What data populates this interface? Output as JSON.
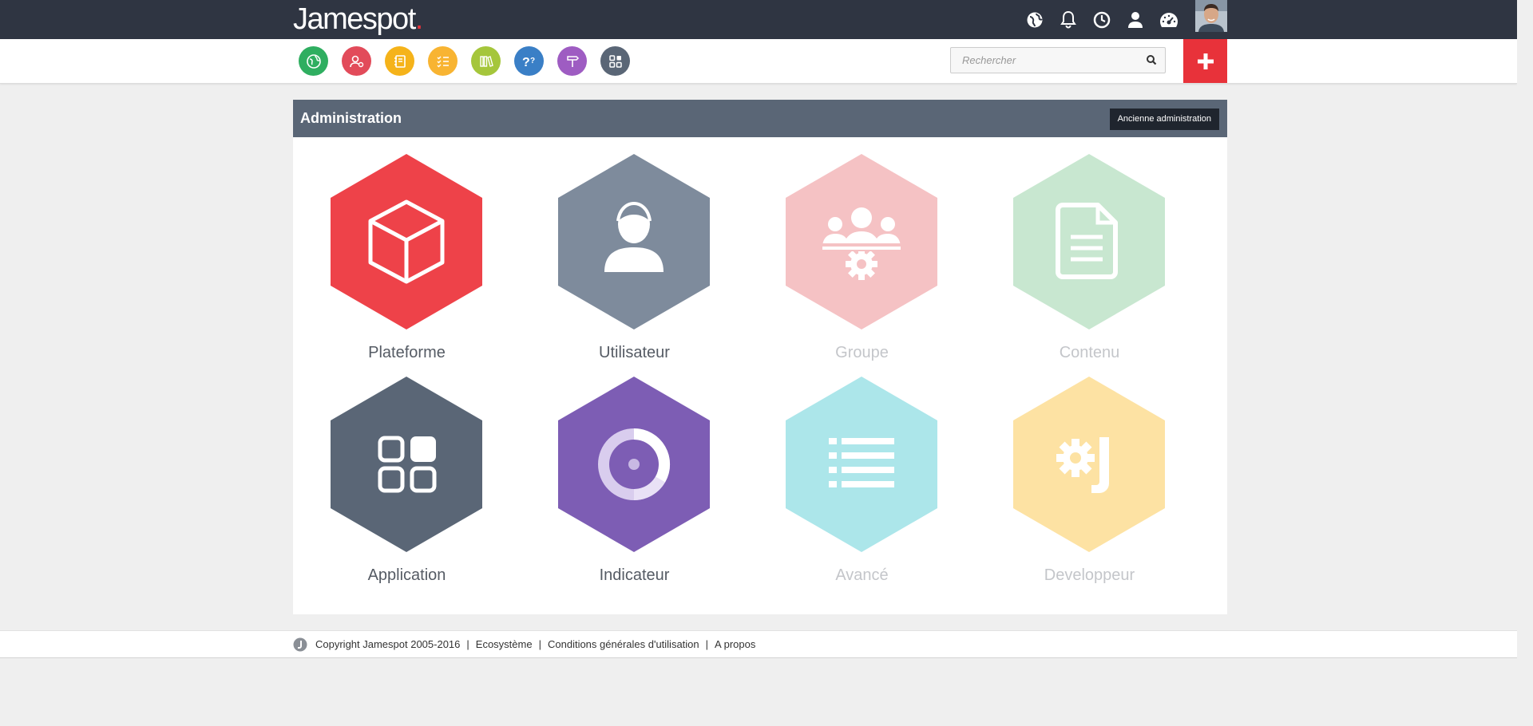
{
  "header": {
    "logo_text": "Jamespot",
    "logo_dot": ".",
    "icons": [
      "globe-icon",
      "bell-icon",
      "clock-icon",
      "user-icon",
      "dashboard-icon"
    ]
  },
  "apps": [
    {
      "name": "globe-app-icon",
      "color": "#2fae60"
    },
    {
      "name": "contacts-app-icon",
      "color": "#e24b5a"
    },
    {
      "name": "notebook-app-icon",
      "color": "#f5b31a"
    },
    {
      "name": "checklist-app-icon",
      "color": "#f8b432"
    },
    {
      "name": "library-app-icon",
      "color": "#a5c63b"
    },
    {
      "name": "help-app-icon",
      "color": "#3a7fc6"
    },
    {
      "name": "signpost-app-icon",
      "color": "#9e5cc2"
    },
    {
      "name": "apps-grid-icon",
      "color": "#5a6676"
    }
  ],
  "search": {
    "placeholder": "Rechercher"
  },
  "panel": {
    "title": "Administration",
    "old_admin_label": "Ancienne administration"
  },
  "tiles": [
    {
      "label": "Plateforme",
      "color": "#ee4249",
      "icon": "cube-icon"
    },
    {
      "label": "Utilisateur",
      "color": "#7e8b9c",
      "icon": "user-icon"
    },
    {
      "label": "Groupe",
      "color": "#f5c2c4",
      "icon": "group-settings-icon"
    },
    {
      "label": "Contenu",
      "color": "#c8e7d0",
      "icon": "document-icon"
    },
    {
      "label": "Application",
      "color": "#5a6676",
      "icon": "apps-grid-icon"
    },
    {
      "label": "Indicateur",
      "color": "#7d5db4",
      "icon": "donut-chart-icon"
    },
    {
      "label": "Avancé",
      "color": "#ace6ea",
      "icon": "list-icon"
    },
    {
      "label": "Developpeur",
      "color": "#fde2a3",
      "icon": "gear-j-icon"
    }
  ],
  "footer": {
    "copyright": "Copyright Jamespot 2005-2016",
    "sep": "|",
    "links": [
      "Ecosystème",
      "Conditions générales d'utilisation",
      "A propos"
    ]
  }
}
